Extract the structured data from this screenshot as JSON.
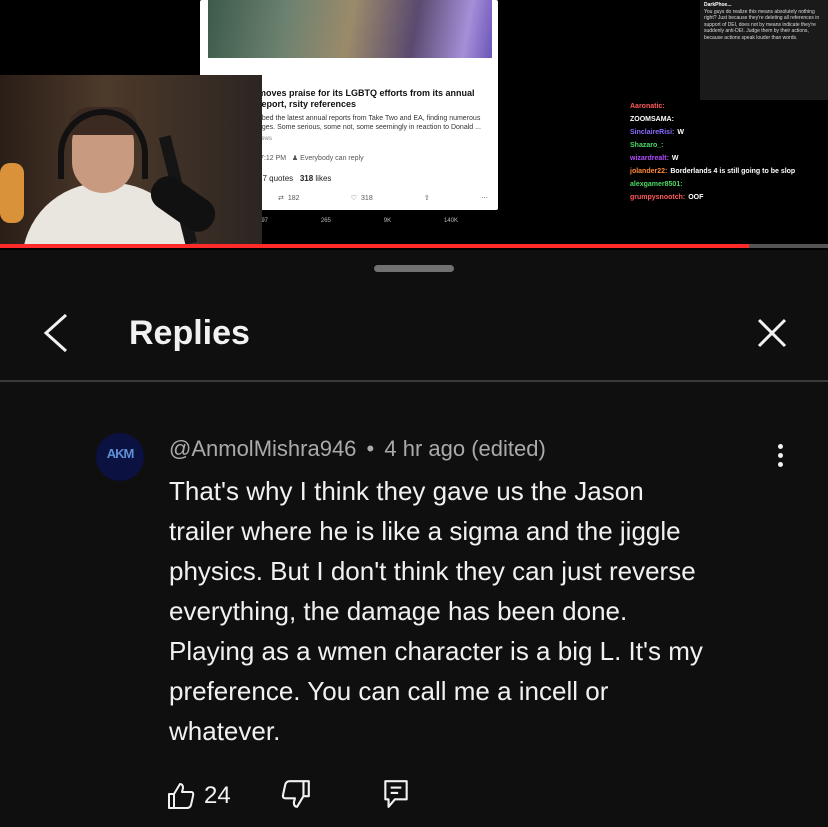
{
  "video": {
    "tweet": {
      "headline": "moves praise for its LGBTQ efforts from its annual report, rsity references",
      "body": "bbed the latest annual reports from Take Two and EA, finding numerous nges. Some serious, some not, some seemingly in reaction to Donald ...",
      "source": "news",
      "time": "7:12 PM",
      "reply_setting": "Everybody can reply",
      "quotes": "57 quotes",
      "likes_value": "318",
      "likes_label": "likes",
      "action_replies": "182",
      "action_likes": "318",
      "bottom_actions": [
        "297",
        "265",
        "9K",
        "140K"
      ]
    },
    "side_tweet": {
      "name": "DarkPhoe...",
      "text": "You guys do realize this means absolutely nothing right? Just because they're deleting all references in support of DEI, does not by means indicate they're suddenly anti-DEI. Judge them by their actions, because actions speak louder than words."
    },
    "chat": [
      {
        "user": "Aaronatic:",
        "msg": "",
        "color": "#ff5a5a"
      },
      {
        "user": "ZOOMSAMA:",
        "msg": "",
        "color": "#ffffff"
      },
      {
        "user": "SinclaireRisi:",
        "msg": "W",
        "color": "#8a6bff"
      },
      {
        "user": "Shazaro_:",
        "msg": "",
        "color": "#4cd964"
      },
      {
        "user": "wizardrealt:",
        "msg": "W",
        "color": "#b04cff"
      },
      {
        "user": "jolander22:",
        "msg": "Borderlands 4 is still going to be slop",
        "color": "#ff8a3c"
      },
      {
        "user": "alexgamer8501:",
        "msg": "",
        "color": "#4cd964"
      },
      {
        "user": "grumpysnootch:",
        "msg": "OOF",
        "color": "#ff5a5a"
      }
    ],
    "progress": 0.905
  },
  "panel": {
    "title": "Replies"
  },
  "comment": {
    "author": "@AnmolMishra946",
    "separator": "•",
    "time": "4 hr ago (edited)",
    "avatar_text": "AKM",
    "text": "That's why I think they gave us the Jason\ntrailer where he is like a sigma and the jiggle\nphysics. But I don't think they can just reverse\neverything, the damage has been done.\nPlaying as a wmen character is a big L. It's my\npreference. You can call me a incell or\nwhatever.",
    "likes": "24"
  },
  "icons": {
    "back": "chevron-left-icon",
    "close": "close-icon",
    "more": "more-vert-icon",
    "like": "thumbs-up-icon",
    "dislike": "thumbs-down-icon",
    "reply": "comment-icon"
  },
  "colors": {
    "background": "#0f0f0f",
    "progress": "#ff2a2a",
    "secondary_text": "#aaaaaa"
  }
}
